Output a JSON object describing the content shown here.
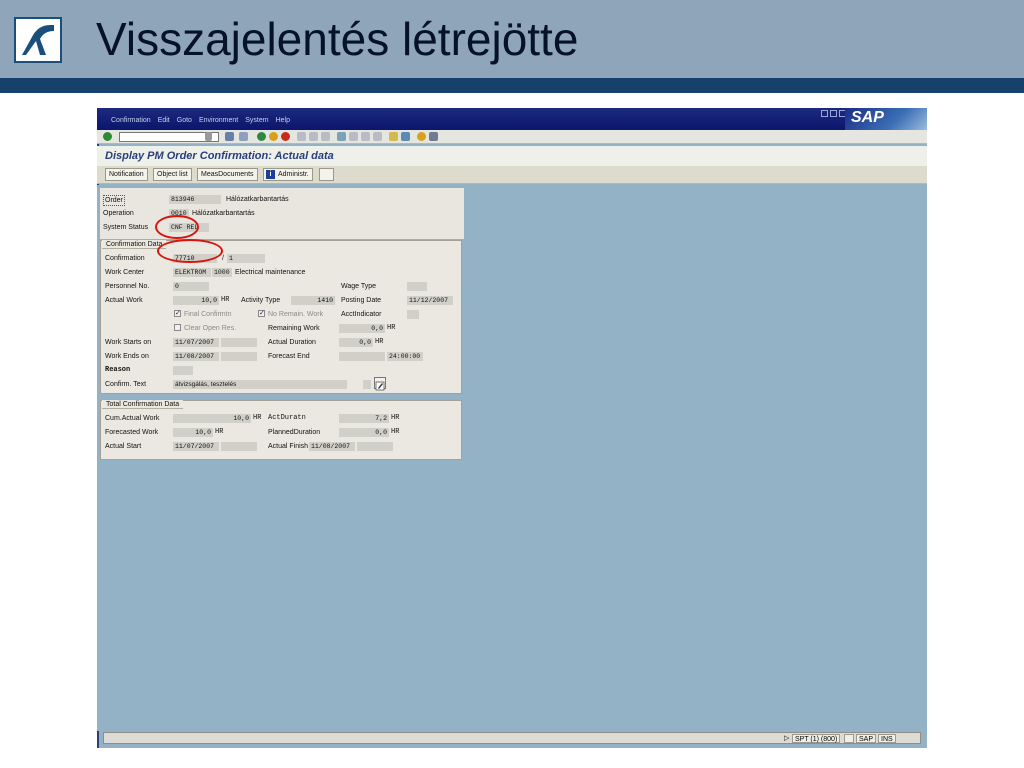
{
  "slide": {
    "title": "Visszajelentés létrejötte"
  },
  "menu": [
    "Confirmation",
    "Edit",
    "Goto",
    "Environment",
    "System",
    "Help"
  ],
  "sap_logo": "SAP",
  "screen_title": "Display PM Order Confirmation: Actual data",
  "app_buttons": [
    "Notification",
    "Object list",
    "MeasDocuments",
    "Administr."
  ],
  "header": {
    "order_label": "Order",
    "order_value": "813946",
    "order_text": "Hálózatkarbantartás",
    "operation_label": "Operation",
    "operation_value": "0010",
    "operation_text": "Hálózatkarbantartás",
    "status_label": "System Status",
    "status_value": "CNF REL"
  },
  "confirmation_data": {
    "title": "Confirmation Data",
    "confirmation_label": "Confirmation",
    "confirmation_value": "77710",
    "confirmation_sep": "/",
    "confirmation_counter": "1",
    "workcenter_label": "Work Center",
    "workcenter_value": "ELEKTROM",
    "workcenter_plant": "1000",
    "workcenter_text": "Electrical maintenance",
    "personnel_label": "Personnel No.",
    "personnel_value": "0",
    "wagetype_label": "Wage Type",
    "actualwork_label": "Actual Work",
    "actualwork_value": "10,0",
    "actualwork_unit": "HR",
    "activitytype_label": "Activity Type",
    "activitytype_value": "1410",
    "postingdate_label": "Posting Date",
    "postingdate_value": "11/12/2007",
    "finalconf_label": "Final Confirmtn",
    "noremain_label": "No Remain. Work",
    "acctind_label": "AcctIndicator",
    "clearopen_label": "Clear Open Res.",
    "remaining_label": "Remaining Work",
    "remaining_value": "0,0",
    "remaining_unit": "HR",
    "workstarts_label": "Work Starts on",
    "workstarts_value": "11/07/2007",
    "actualduration_label": "Actual Duration",
    "actualduration_value": "0,0",
    "actualduration_unit": "HR",
    "workends_label": "Work Ends on",
    "workends_value": "11/08/2007",
    "forecastend_label": "Forecast End",
    "forecastend_time": "24:00:00",
    "reason_label": "Reason",
    "confirmtext_label": "Confirm. Text",
    "confirmtext_value": "átvizsgálás, tesztelés"
  },
  "total_data": {
    "title": "Total Confirmation Data",
    "cumactual_label": "Cum.Actual Work",
    "cumactual_value": "10,0",
    "cumactual_unit": "HR",
    "actdur_label": "ActDuratn",
    "actdur_value": "7,2",
    "actdur_unit": "HR",
    "forecasted_label": "Forecasted Work",
    "forecasted_value": "10,0",
    "forecasted_unit": "HR",
    "planneddur_label": "PlannedDuration",
    "planneddur_value": "0,0",
    "planneddur_unit": "HR",
    "actualstart_label": "Actual Start",
    "actualstart_value": "11/07/2007",
    "actualfinish_label": "Actual Finish",
    "actualfinish_value": "11/08/2007"
  },
  "status_bar": {
    "system": "SPT (1) (800)",
    "server": "SAP",
    "mode": "INS"
  },
  "colors": {
    "slide_header": "#8fa5ba",
    "slide_band": "#16416a",
    "sap_background": "#94b2c6",
    "highlight_circle": "#d8140e"
  }
}
